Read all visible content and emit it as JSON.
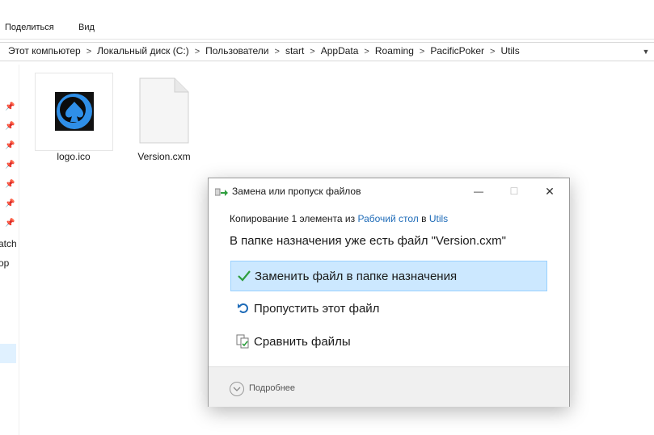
{
  "ribbon": {
    "tabs": [
      "Поделиться",
      "Вид"
    ]
  },
  "address": {
    "crumbs": [
      "Этот компьютер",
      "Локальный диск (C:)",
      "Пользователи",
      "start",
      "AppData",
      "Roaming",
      "PacificPoker",
      "Utils"
    ]
  },
  "navpane": {
    "items": [
      "atch",
      "op"
    ]
  },
  "files": [
    {
      "name": "logo.ico",
      "icon": "poker-spade-icon"
    },
    {
      "name": "Version.cxm",
      "icon": "blank-file-icon"
    }
  ],
  "dialog": {
    "title": "Замена или пропуск файлов",
    "copy_prefix": "Копирование 1 элемента из ",
    "copy_source": "Рабочий стол",
    "copy_mid": " в ",
    "copy_dest": "Utils",
    "heading": "В папке назначения уже есть файл \"Version.cxm\"",
    "options": [
      {
        "label": "Заменить файл в папке назначения",
        "icon": "checkmark-icon",
        "selected": true
      },
      {
        "label": "Пропустить этот файл",
        "icon": "skip-arrow-icon",
        "selected": false
      },
      {
        "label": "Сравнить файлы",
        "icon": "compare-files-icon",
        "selected": false
      }
    ],
    "more_label": "Подробнее",
    "controls": {
      "minimize": "—",
      "maximize": "☐",
      "close": "✕"
    }
  },
  "colors": {
    "accent": "#1e6bb8",
    "selection": "#cce8ff",
    "check": "#2e9e3e"
  }
}
